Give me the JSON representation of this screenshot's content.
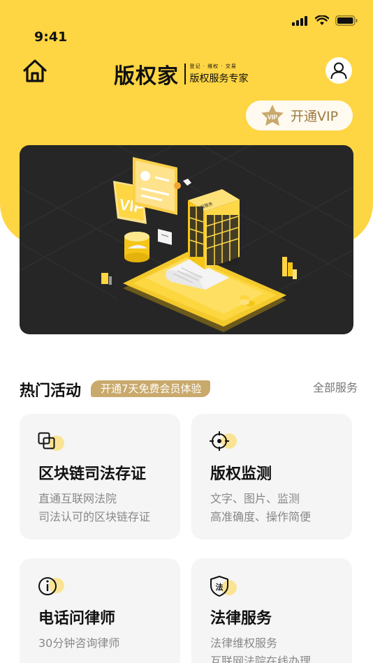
{
  "status_bar": {
    "time": "9:41"
  },
  "header": {
    "logo_main": "版权家",
    "logo_tagline_small": "登记 · 维权 · 交易",
    "logo_tagline": "版权服务专家",
    "vip_badge": "VIP",
    "vip_button_label": "开通VIP"
  },
  "banner": {
    "screen_text": "VIP",
    "building_label": "版权服务"
  },
  "section": {
    "title": "热门活动",
    "promo": "开通7天免费会员体验",
    "all_services": "全部服务"
  },
  "services": [
    {
      "icon": "copy-squares-icon",
      "title": "区块链司法存证",
      "line1": "直通互联网法院",
      "line2": "司法认可的区块链存证"
    },
    {
      "icon": "crosshair-target-icon",
      "title": "版权监测",
      "line1": "文字、图片、监测",
      "line2": "高准确度、操作简便"
    },
    {
      "icon": "info-circle-icon",
      "title": "电话问律师",
      "line1": "30分钟咨询律师",
      "line2": ""
    },
    {
      "icon": "law-shield-icon",
      "title": "法律服务",
      "line1": "法律维权服务",
      "line2": "互联网法院在线办理"
    }
  ],
  "colors": {
    "brand_yellow": "#fed543",
    "gold": "#c9a96c",
    "card_bg": "#f5f5f5",
    "banner_bg": "#262626"
  }
}
